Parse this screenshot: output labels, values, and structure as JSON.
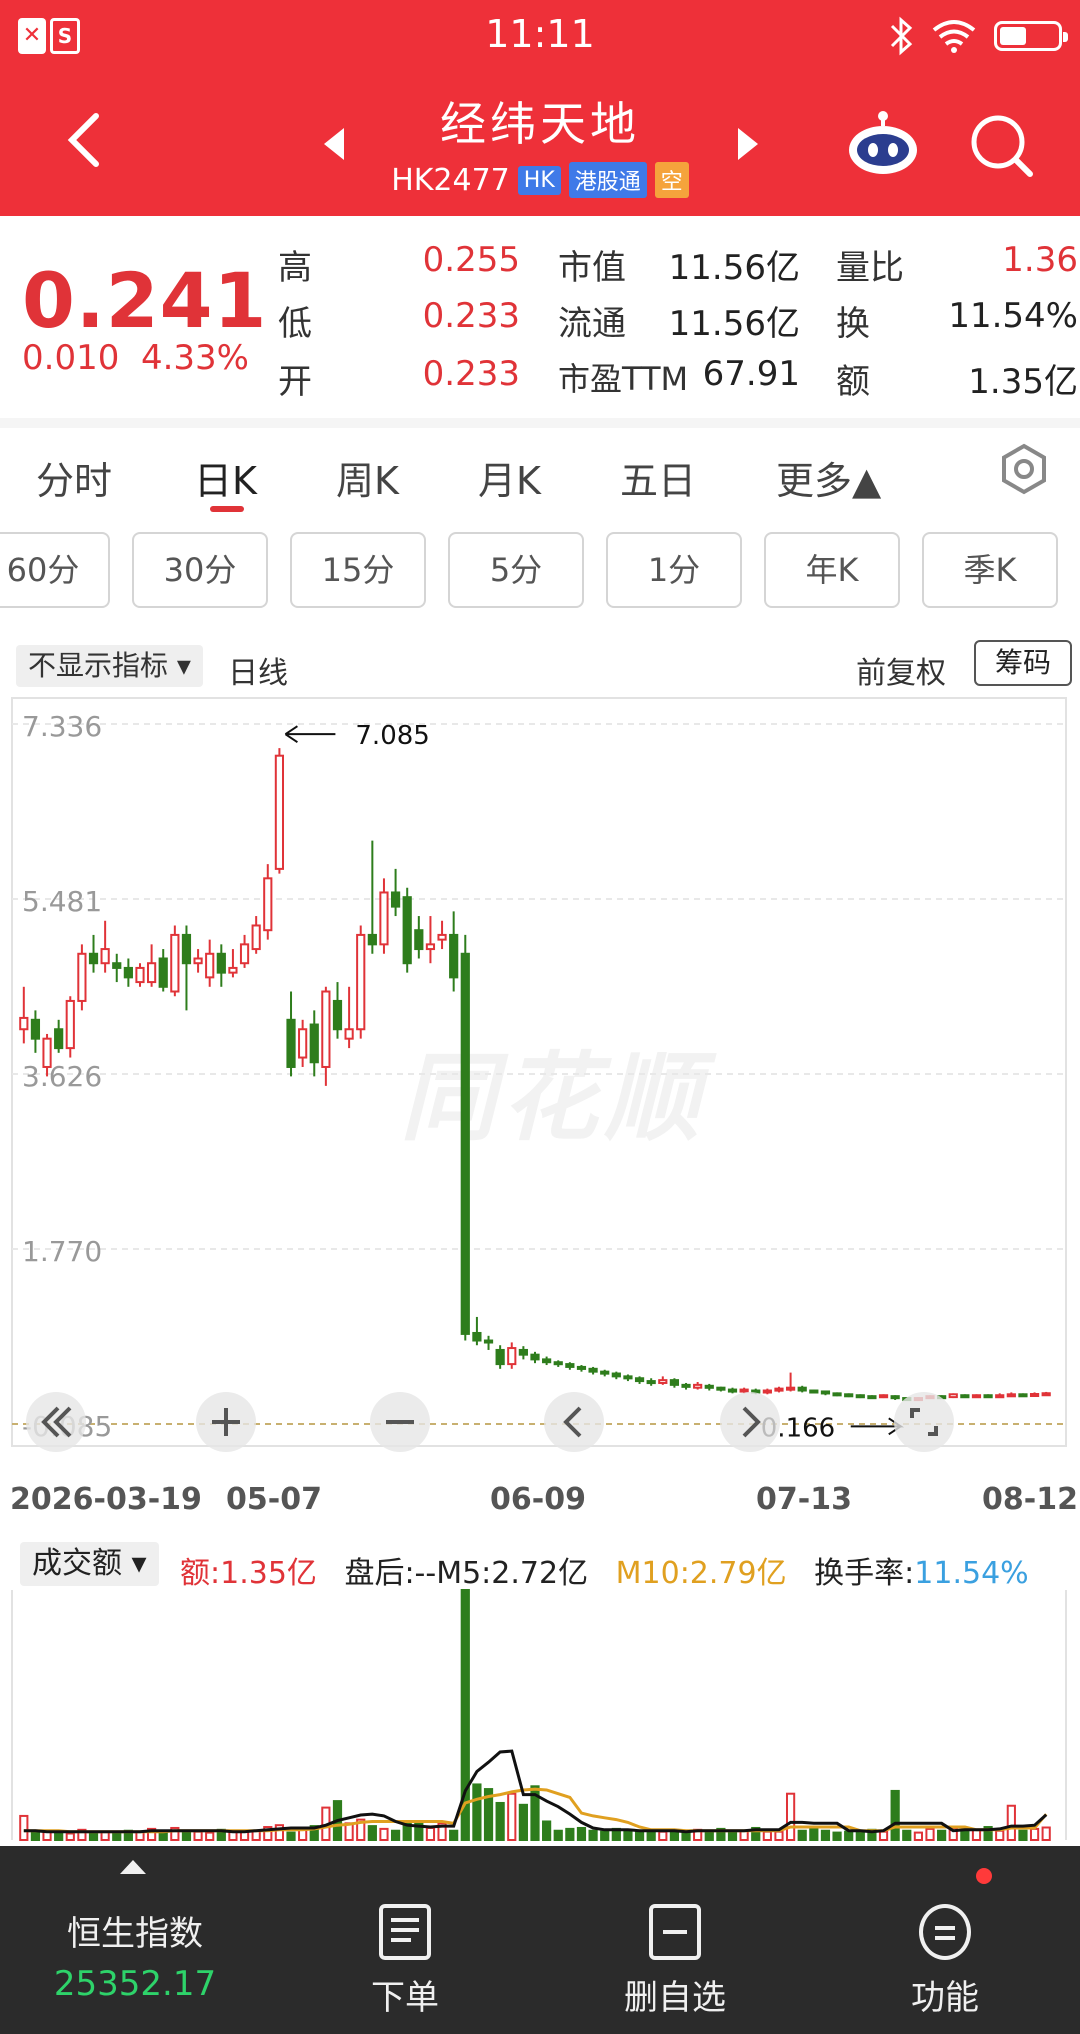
{
  "status_bar": {
    "time": "11:11",
    "left_icons": [
      "close-badge-icon",
      "app-badge-icon"
    ],
    "right_icons": [
      "bluetooth-icon",
      "wifi-icon",
      "battery-icon"
    ]
  },
  "header": {
    "title": "经纬天地",
    "code": "HK2477",
    "badges": [
      "HK",
      "港股通",
      "空"
    ],
    "colors": {
      "bg": "#ee3039",
      "badge_blue": "#3f7ae8",
      "badge_orange": "#f5a33c"
    }
  },
  "quote": {
    "price": "0.241",
    "change": "0.010",
    "change_pct": "4.33%",
    "rows": [
      {
        "k1": "高",
        "v1": "0.255",
        "k2": "市值",
        "v2": "11.56亿",
        "k3": "量比",
        "v3": "1.36"
      },
      {
        "k1": "低",
        "v1": "0.233",
        "k2": "流通",
        "v2": "11.56亿",
        "k3": "换",
        "v3": "11.54%"
      },
      {
        "k1": "开",
        "v1": "0.233",
        "k2": "市盈TTM",
        "v2": "67.91",
        "k3": "额",
        "v3": "1.35亿"
      }
    ]
  },
  "tabs": [
    "分时",
    "日K",
    "周K",
    "月K",
    "五日",
    "更多▲"
  ],
  "period_tabs": [
    "60分",
    "30分",
    "15分",
    "5分",
    "1分",
    "年K",
    "季K"
  ],
  "chart_header": {
    "indicator": "不显示指标 ▾",
    "line": "日线",
    "fq": "前复权",
    "chip": "筹码"
  },
  "watermark": "同花顺",
  "chart_data": [
    {
      "type": "candlestick",
      "y_ticks": [
        "7.336",
        "5.481",
        "3.626",
        "1.770",
        "-0.085"
      ],
      "ylim": [
        -0.085,
        7.336
      ],
      "x_ticks": [
        "2026-03-19",
        "05-07",
        "06-09",
        "07-13",
        "08-12"
      ],
      "annotations": {
        "max": "7.085",
        "min": "0.166"
      },
      "series": [
        {
          "open": 4.1,
          "close": 4.22,
          "high": 4.55,
          "low": 3.95
        },
        {
          "open": 4.2,
          "close": 4.0,
          "high": 4.3,
          "low": 3.85
        },
        {
          "open": 3.7,
          "close": 4.0,
          "high": 4.05,
          "low": 3.6
        },
        {
          "open": 4.1,
          "close": 3.9,
          "high": 4.2,
          "low": 3.85
        },
        {
          "open": 3.9,
          "close": 4.4,
          "high": 4.45,
          "low": 3.8
        },
        {
          "open": 4.4,
          "close": 4.9,
          "high": 5.0,
          "low": 4.3
        },
        {
          "open": 4.9,
          "close": 4.8,
          "high": 5.1,
          "low": 4.7
        },
        {
          "open": 4.8,
          "close": 4.95,
          "high": 5.25,
          "low": 4.7
        },
        {
          "open": 4.8,
          "close": 4.75,
          "high": 4.9,
          "low": 4.6
        },
        {
          "open": 4.75,
          "close": 4.65,
          "high": 4.85,
          "low": 4.55
        },
        {
          "open": 4.6,
          "close": 4.75,
          "high": 4.8,
          "low": 4.55
        },
        {
          "open": 4.6,
          "close": 4.8,
          "high": 5.0,
          "low": 4.55
        },
        {
          "open": 4.85,
          "close": 4.55,
          "high": 4.95,
          "low": 4.5
        },
        {
          "open": 4.5,
          "close": 5.1,
          "high": 5.2,
          "low": 4.45
        },
        {
          "open": 5.1,
          "close": 4.8,
          "high": 5.2,
          "low": 4.3
        },
        {
          "open": 4.8,
          "close": 4.85,
          "high": 4.95,
          "low": 4.7
        },
        {
          "open": 4.65,
          "close": 4.9,
          "high": 5.05,
          "low": 4.55
        },
        {
          "open": 4.9,
          "close": 4.7,
          "high": 5.0,
          "low": 4.55
        },
        {
          "open": 4.7,
          "close": 4.75,
          "high": 4.95,
          "low": 4.65
        },
        {
          "open": 4.8,
          "close": 5.0,
          "high": 5.1,
          "low": 4.75
        },
        {
          "open": 4.95,
          "close": 5.2,
          "high": 5.3,
          "low": 4.9
        },
        {
          "open": 5.15,
          "close": 5.7,
          "high": 5.85,
          "low": 5.05
        },
        {
          "open": 5.8,
          "close": 7.0,
          "high": 7.08,
          "low": 5.75
        },
        {
          "open": 4.2,
          "close": 3.7,
          "high": 4.5,
          "low": 3.6
        },
        {
          "open": 3.8,
          "close": 4.1,
          "high": 4.2,
          "low": 3.7
        },
        {
          "open": 4.15,
          "close": 3.75,
          "high": 4.3,
          "low": 3.6
        },
        {
          "open": 3.7,
          "close": 4.5,
          "high": 4.55,
          "low": 3.5
        },
        {
          "open": 4.4,
          "close": 4.1,
          "high": 4.6,
          "low": 4.0
        },
        {
          "open": 4.0,
          "close": 4.1,
          "high": 4.55,
          "low": 3.9
        },
        {
          "open": 4.1,
          "close": 5.1,
          "high": 5.2,
          "low": 4.0
        },
        {
          "open": 5.1,
          "close": 5.0,
          "high": 6.1,
          "low": 4.9
        },
        {
          "open": 5.0,
          "close": 5.55,
          "high": 5.7,
          "low": 4.9
        },
        {
          "open": 5.55,
          "close": 5.4,
          "high": 5.8,
          "low": 5.3
        },
        {
          "open": 5.5,
          "close": 4.8,
          "high": 5.6,
          "low": 4.7
        },
        {
          "open": 5.15,
          "close": 4.95,
          "high": 5.3,
          "low": 4.85
        },
        {
          "open": 4.95,
          "close": 5.0,
          "high": 5.3,
          "low": 4.8
        },
        {
          "open": 5.05,
          "close": 5.1,
          "high": 5.25,
          "low": 4.95
        },
        {
          "open": 5.1,
          "close": 4.65,
          "high": 5.35,
          "low": 4.5
        },
        {
          "open": 4.9,
          "close": 0.87,
          "high": 5.1,
          "low": 0.8
        },
        {
          "open": 0.88,
          "close": 0.8,
          "high": 1.05,
          "low": 0.75
        },
        {
          "open": 0.8,
          "close": 0.78,
          "high": 0.85,
          "low": 0.7
        },
        {
          "open": 0.7,
          "close": 0.55,
          "high": 0.75,
          "low": 0.5
        },
        {
          "open": 0.55,
          "close": 0.72,
          "high": 0.78,
          "low": 0.5
        },
        {
          "open": 0.7,
          "close": 0.65,
          "high": 0.74,
          "low": 0.6
        },
        {
          "open": 0.65,
          "close": 0.6,
          "high": 0.68,
          "low": 0.56
        },
        {
          "open": 0.6,
          "close": 0.57,
          "high": 0.63,
          "low": 0.54
        },
        {
          "open": 0.57,
          "close": 0.55,
          "high": 0.59,
          "low": 0.52
        },
        {
          "open": 0.55,
          "close": 0.52,
          "high": 0.57,
          "low": 0.49
        },
        {
          "open": 0.52,
          "close": 0.5,
          "high": 0.54,
          "low": 0.47
        },
        {
          "open": 0.5,
          "close": 0.47,
          "high": 0.52,
          "low": 0.44
        },
        {
          "open": 0.47,
          "close": 0.45,
          "high": 0.49,
          "low": 0.42
        },
        {
          "open": 0.45,
          "close": 0.42,
          "high": 0.47,
          "low": 0.39
        },
        {
          "open": 0.42,
          "close": 0.4,
          "high": 0.44,
          "low": 0.37
        },
        {
          "open": 0.4,
          "close": 0.37,
          "high": 0.42,
          "low": 0.34
        },
        {
          "open": 0.37,
          "close": 0.35,
          "high": 0.4,
          "low": 0.32
        },
        {
          "open": 0.35,
          "close": 0.38,
          "high": 0.42,
          "low": 0.33
        },
        {
          "open": 0.38,
          "close": 0.33,
          "high": 0.4,
          "low": 0.3
        },
        {
          "open": 0.33,
          "close": 0.31,
          "high": 0.35,
          "low": 0.28
        },
        {
          "open": 0.3,
          "close": 0.33,
          "high": 0.36,
          "low": 0.28
        },
        {
          "open": 0.32,
          "close": 0.3,
          "high": 0.34,
          "low": 0.27
        },
        {
          "open": 0.3,
          "close": 0.28,
          "high": 0.31,
          "low": 0.26
        },
        {
          "open": 0.28,
          "close": 0.26,
          "high": 0.3,
          "low": 0.24
        },
        {
          "open": 0.26,
          "close": 0.28,
          "high": 0.3,
          "low": 0.24
        },
        {
          "open": 0.27,
          "close": 0.25,
          "high": 0.29,
          "low": 0.23
        },
        {
          "open": 0.25,
          "close": 0.27,
          "high": 0.29,
          "low": 0.23
        },
        {
          "open": 0.27,
          "close": 0.29,
          "high": 0.31,
          "low": 0.25
        },
        {
          "open": 0.28,
          "close": 0.3,
          "high": 0.46,
          "low": 0.26
        },
        {
          "open": 0.3,
          "close": 0.27,
          "high": 0.32,
          "low": 0.25
        },
        {
          "open": 0.27,
          "close": 0.26,
          "high": 0.28,
          "low": 0.24
        },
        {
          "open": 0.26,
          "close": 0.24,
          "high": 0.27,
          "low": 0.22
        },
        {
          "open": 0.24,
          "close": 0.23,
          "high": 0.25,
          "low": 0.21
        },
        {
          "open": 0.23,
          "close": 0.22,
          "high": 0.24,
          "low": 0.2
        },
        {
          "open": 0.22,
          "close": 0.21,
          "high": 0.23,
          "low": 0.19
        },
        {
          "open": 0.21,
          "close": 0.2,
          "high": 0.22,
          "low": 0.18
        },
        {
          "open": 0.2,
          "close": 0.22,
          "high": 0.23,
          "low": 0.19
        },
        {
          "open": 0.21,
          "close": 0.19,
          "high": 0.22,
          "low": 0.17
        },
        {
          "open": 0.19,
          "close": 0.18,
          "high": 0.2,
          "low": 0.166
        },
        {
          "open": 0.18,
          "close": 0.19,
          "high": 0.2,
          "low": 0.17
        },
        {
          "open": 0.19,
          "close": 0.21,
          "high": 0.22,
          "low": 0.18
        },
        {
          "open": 0.21,
          "close": 0.2,
          "high": 0.22,
          "low": 0.19
        },
        {
          "open": 0.2,
          "close": 0.23,
          "high": 0.24,
          "low": 0.19
        },
        {
          "open": 0.22,
          "close": 0.21,
          "high": 0.23,
          "low": 0.2
        },
        {
          "open": 0.21,
          "close": 0.22,
          "high": 0.23,
          "low": 0.2
        },
        {
          "open": 0.22,
          "close": 0.21,
          "high": 0.23,
          "low": 0.2
        },
        {
          "open": 0.21,
          "close": 0.22,
          "high": 0.24,
          "low": 0.2
        },
        {
          "open": 0.22,
          "close": 0.23,
          "high": 0.25,
          "low": 0.21
        },
        {
          "open": 0.23,
          "close": 0.22,
          "high": 0.24,
          "low": 0.21
        },
        {
          "open": 0.22,
          "close": 0.233,
          "high": 0.25,
          "low": 0.21
        },
        {
          "open": 0.233,
          "close": 0.241,
          "high": 0.255,
          "low": 0.233
        }
      ],
      "colors": {
        "up": "#e03338",
        "down": "#2e7d1c"
      },
      "grid": true
    },
    {
      "type": "bar",
      "label_select": "成交额 ▾",
      "legend": [
        {
          "text": "额:1.35亿",
          "color": "#e03338"
        },
        {
          "text": "盘后:--M5:2.72亿",
          "color": "#222222"
        },
        {
          "text": "M10:2.79亿",
          "color": "#e0a020"
        },
        {
          "text": "换手率:",
          "color": "#222222"
        },
        {
          "text": "11.54%",
          "color": "#3aa0e0"
        }
      ],
      "values": [
        2.6,
        0.9,
        1.0,
        0.8,
        0.7,
        1.1,
        0.8,
        0.9,
        0.7,
        1.0,
        0.9,
        1.2,
        0.8,
        1.3,
        0.9,
        0.9,
        0.8,
        1.1,
        0.9,
        0.9,
        1.0,
        1.4,
        1.6,
        0.8,
        1.1,
        1.5,
        3.5,
        4.2,
        1.8,
        2.2,
        1.5,
        1.2,
        1.0,
        1.8,
        1.9,
        1.3,
        1.8,
        1.0,
        27.0,
        6.0,
        5.5,
        4.0,
        5.0,
        3.8,
        5.8,
        2.0,
        1.0,
        1.2,
        1.3,
        1.0,
        0.9,
        1.2,
        1.0,
        0.9,
        1.1,
        0.9,
        1.0,
        0.8,
        1.1,
        0.9,
        1.2,
        0.9,
        1.0,
        1.3,
        0.9,
        0.9,
        5.0,
        1.0,
        1.2,
        1.0,
        0.8,
        0.9,
        1.0,
        1.1,
        0.9,
        5.3,
        1.0,
        0.8,
        1.2,
        1.0,
        1.3,
        0.9,
        1.1,
        1.4,
        1.0,
        3.7,
        1.0,
        1.2,
        1.35
      ],
      "m5": [
        1.0,
        1.0,
        0.9,
        0.9,
        0.9,
        0.9,
        0.9,
        0.9,
        0.9,
        0.9,
        0.9,
        1.0,
        1.0,
        1.0,
        1.0,
        1.0,
        1.0,
        1.0,
        0.9,
        0.9,
        1.0,
        1.1,
        1.2,
        1.3,
        1.3,
        1.3,
        1.6,
        2.1,
        2.4,
        2.7,
        2.8,
        2.6,
        2.0,
        1.6,
        1.5,
        1.4,
        1.5,
        1.5,
        5.3,
        7.4,
        8.4,
        9.5,
        9.6,
        4.9,
        4.9,
        4.2,
        3.6,
        2.8,
        1.9,
        1.3,
        1.1,
        1.1,
        1.1,
        1.0,
        1.0,
        1.0,
        1.0,
        0.9,
        1.0,
        1.0,
        1.0,
        1.0,
        1.0,
        1.1,
        1.1,
        1.1,
        1.9,
        1.9,
        1.8,
        1.8,
        1.8,
        1.0,
        1.0,
        0.9,
        1.0,
        1.8,
        1.8,
        1.8,
        1.8,
        1.8,
        1.0,
        1.1,
        1.1,
        1.1,
        1.2,
        1.5,
        1.5,
        1.6,
        2.72
      ],
      "m10": [
        1.0,
        1.0,
        1.0,
        1.0,
        0.9,
        0.9,
        0.9,
        0.9,
        0.9,
        0.9,
        0.9,
        0.9,
        0.9,
        1.0,
        1.0,
        1.0,
        1.0,
        1.0,
        1.0,
        1.0,
        1.0,
        1.0,
        1.1,
        1.1,
        1.1,
        1.2,
        1.4,
        1.6,
        1.7,
        1.9,
        2.0,
        2.0,
        2.0,
        2.0,
        2.0,
        2.0,
        2.0,
        1.8,
        4.0,
        4.4,
        4.7,
        4.9,
        5.2,
        5.4,
        5.5,
        5.4,
        5.0,
        4.6,
        2.9,
        2.6,
        2.4,
        2.2,
        1.9,
        1.4,
        1.1,
        1.1,
        1.1,
        1.0,
        1.0,
        1.0,
        1.0,
        1.0,
        1.0,
        1.0,
        1.0,
        1.0,
        1.4,
        1.4,
        1.4,
        1.4,
        1.4,
        1.4,
        1.0,
        1.0,
        1.0,
        1.4,
        1.4,
        1.4,
        1.4,
        1.4,
        1.4,
        1.4,
        1.1,
        1.1,
        1.1,
        1.3,
        1.3,
        1.3,
        2.79
      ],
      "colors": {
        "up": "#e03338",
        "down": "#2e7d1c",
        "m5": "#111111",
        "m10": "#e0a020"
      }
    }
  ],
  "overlay_controls": [
    "double-left-icon",
    "zoom-in-icon",
    "zoom-out-icon",
    "left-icon",
    "right-icon",
    "fullscreen-icon"
  ],
  "bottom_nav": {
    "index_name": "恒生指数",
    "index_value": "25352.17",
    "items": [
      {
        "label": "下单",
        "icon": "document-icon"
      },
      {
        "label": "删自选",
        "icon": "minus-box-icon"
      },
      {
        "label": "功能",
        "icon": "menu-circle-icon"
      }
    ]
  }
}
